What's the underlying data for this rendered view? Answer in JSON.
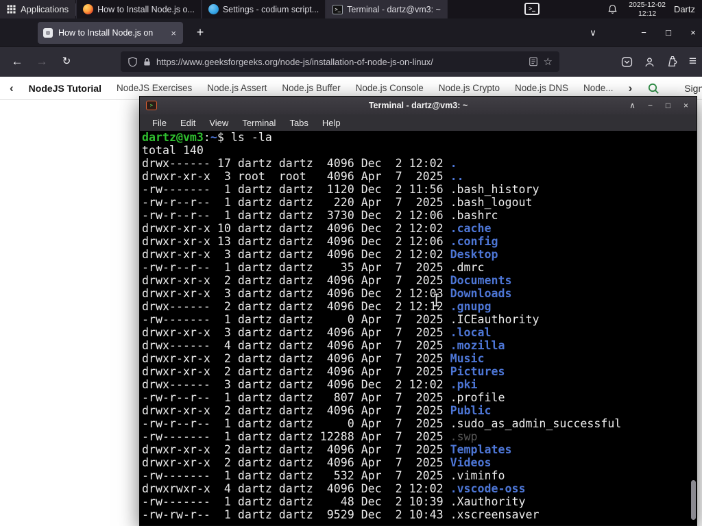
{
  "icons": {
    "back": "←",
    "forward": "→",
    "reload": "↻",
    "new_tab": "+",
    "all_tabs": "∨",
    "menu": "≡",
    "star": "☆",
    "tab_close": "×",
    "minimize": "−",
    "maximize": "□",
    "close": "×",
    "shade": "∧",
    "nav_back": "‹",
    "nav_forward": "›",
    "tray_glyph": ">_",
    "terminal_task_glyph": ">_"
  },
  "colors": {
    "gfg_green": "#2f8d46",
    "dir_blue": "#4d76d6",
    "prompt_green": "#2fbf2f"
  },
  "panel": {
    "applications": "Applications",
    "tasks": [
      {
        "title": "How to Install Node.js o...",
        "icon": "firefox"
      },
      {
        "title": "Settings - codium script...",
        "icon": "codium"
      },
      {
        "title": "Terminal - dartz@vm3: ~",
        "icon": "terminal",
        "active": true
      }
    ],
    "date": "2025-12-02",
    "time": "12:12",
    "user": "Dartz"
  },
  "browser": {
    "tab_title": "How to Install Node.js on",
    "url": "https://www.geeksforgeeks.org/node-js/installation-of-node-js-on-linux/"
  },
  "site_nav": {
    "primary": "NodeJS Tutorial",
    "items": [
      "NodeJS Exercises",
      "Node.js Assert",
      "Node.js Buffer",
      "Node.js Console",
      "Node.js Crypto",
      "Node.js DNS",
      "Node..."
    ],
    "sign_in": "Sign In"
  },
  "terminal": {
    "title": "Terminal - dartz@vm3: ~",
    "menu": [
      "File",
      "Edit",
      "View",
      "Terminal",
      "Tabs",
      "Help"
    ],
    "lines": [
      [
        {
          "t": "dartz@vm3",
          "c": "g"
        },
        {
          "t": ":",
          "c": "p"
        },
        {
          "t": "~",
          "c": "d"
        },
        {
          "t": "$ ls -la",
          "c": "p"
        }
      ],
      [
        {
          "t": "total 140",
          "c": "p"
        }
      ],
      [
        {
          "t": "drwx------ 17 dartz dartz  4096 Dec  2 12:02 ",
          "c": "p"
        },
        {
          "t": ".",
          "c": "d"
        }
      ],
      [
        {
          "t": "drwxr-xr-x  3 root  root   4096 Apr  7  2025 ",
          "c": "p"
        },
        {
          "t": "..",
          "c": "d"
        }
      ],
      [
        {
          "t": "-rw-------  1 dartz dartz  1120 Dec  2 11:56 .bash_history",
          "c": "p"
        }
      ],
      [
        {
          "t": "-rw-r--r--  1 dartz dartz   220 Apr  7  2025 .bash_logout",
          "c": "p"
        }
      ],
      [
        {
          "t": "-rw-r--r--  1 dartz dartz  3730 Dec  2 12:06 .bashrc",
          "c": "p"
        }
      ],
      [
        {
          "t": "drwxr-xr-x 10 dartz dartz  4096 Dec  2 12:02 ",
          "c": "p"
        },
        {
          "t": ".cache",
          "c": "d"
        }
      ],
      [
        {
          "t": "drwxr-xr-x 13 dartz dartz  4096 Dec  2 12:06 ",
          "c": "p"
        },
        {
          "t": ".config",
          "c": "d"
        }
      ],
      [
        {
          "t": "drwxr-xr-x  3 dartz dartz  4096 Dec  2 12:02 ",
          "c": "p"
        },
        {
          "t": "Desktop",
          "c": "d"
        }
      ],
      [
        {
          "t": "-rw-r--r--  1 dartz dartz    35 Apr  7  2025 .dmrc",
          "c": "p"
        }
      ],
      [
        {
          "t": "drwxr-xr-x  2 dartz dartz  4096 Apr  7  2025 ",
          "c": "p"
        },
        {
          "t": "Documents",
          "c": "d"
        }
      ],
      [
        {
          "t": "drwxr-xr-x  3 dartz dartz  4096 Dec  2 12:03 ",
          "c": "p"
        },
        {
          "t": "Downloads",
          "c": "d"
        }
      ],
      [
        {
          "t": "drwx------  2 dartz dartz  4096 Dec  2 12:12 ",
          "c": "p"
        },
        {
          "t": ".gnupg",
          "c": "d"
        }
      ],
      [
        {
          "t": "-rw-------  1 dartz dartz     0 Apr  7  2025 .ICEauthority",
          "c": "p"
        }
      ],
      [
        {
          "t": "drwxr-xr-x  3 dartz dartz  4096 Apr  7  2025 ",
          "c": "p"
        },
        {
          "t": ".local",
          "c": "d"
        }
      ],
      [
        {
          "t": "drwx------  4 dartz dartz  4096 Apr  7  2025 ",
          "c": "p"
        },
        {
          "t": ".mozilla",
          "c": "d"
        }
      ],
      [
        {
          "t": "drwxr-xr-x  2 dartz dartz  4096 Apr  7  2025 ",
          "c": "p"
        },
        {
          "t": "Music",
          "c": "d"
        }
      ],
      [
        {
          "t": "drwxr-xr-x  2 dartz dartz  4096 Apr  7  2025 ",
          "c": "p"
        },
        {
          "t": "Pictures",
          "c": "d"
        }
      ],
      [
        {
          "t": "drwx------  3 dartz dartz  4096 Dec  2 12:02 ",
          "c": "p"
        },
        {
          "t": ".pki",
          "c": "d"
        }
      ],
      [
        {
          "t": "-rw-r--r--  1 dartz dartz   807 Apr  7  2025 .profile",
          "c": "p"
        }
      ],
      [
        {
          "t": "drwxr-xr-x  2 dartz dartz  4096 Apr  7  2025 ",
          "c": "p"
        },
        {
          "t": "Public",
          "c": "d"
        }
      ],
      [
        {
          "t": "-rw-r--r--  1 dartz dartz     0 Apr  7  2025 .sudo_as_admin_successful",
          "c": "p"
        }
      ],
      [
        {
          "t": "-rw-------  1 dartz dartz 12288 Apr  7  2025 ",
          "c": "p"
        },
        {
          "t": ".swp",
          "c": "dim"
        }
      ],
      [
        {
          "t": "drwxr-xr-x  2 dartz dartz  4096 Apr  7  2025 ",
          "c": "p"
        },
        {
          "t": "Templates",
          "c": "d"
        }
      ],
      [
        {
          "t": "drwxr-xr-x  2 dartz dartz  4096 Apr  7  2025 ",
          "c": "p"
        },
        {
          "t": "Videos",
          "c": "d"
        }
      ],
      [
        {
          "t": "-rw-------  1 dartz dartz   532 Apr  7  2025 .viminfo",
          "c": "p"
        }
      ],
      [
        {
          "t": "drwxrwxr-x  4 dartz dartz  4096 Dec  2 12:02 ",
          "c": "p"
        },
        {
          "t": ".vscode-oss",
          "c": "d"
        }
      ],
      [
        {
          "t": "-rw-------  1 dartz dartz    48 Dec  2 10:39 .Xauthority",
          "c": "p"
        }
      ],
      [
        {
          "t": "-rw-rw-r--  1 dartz dartz  9529 Dec  2 10:43 .xscreensaver",
          "c": "p"
        }
      ]
    ]
  }
}
